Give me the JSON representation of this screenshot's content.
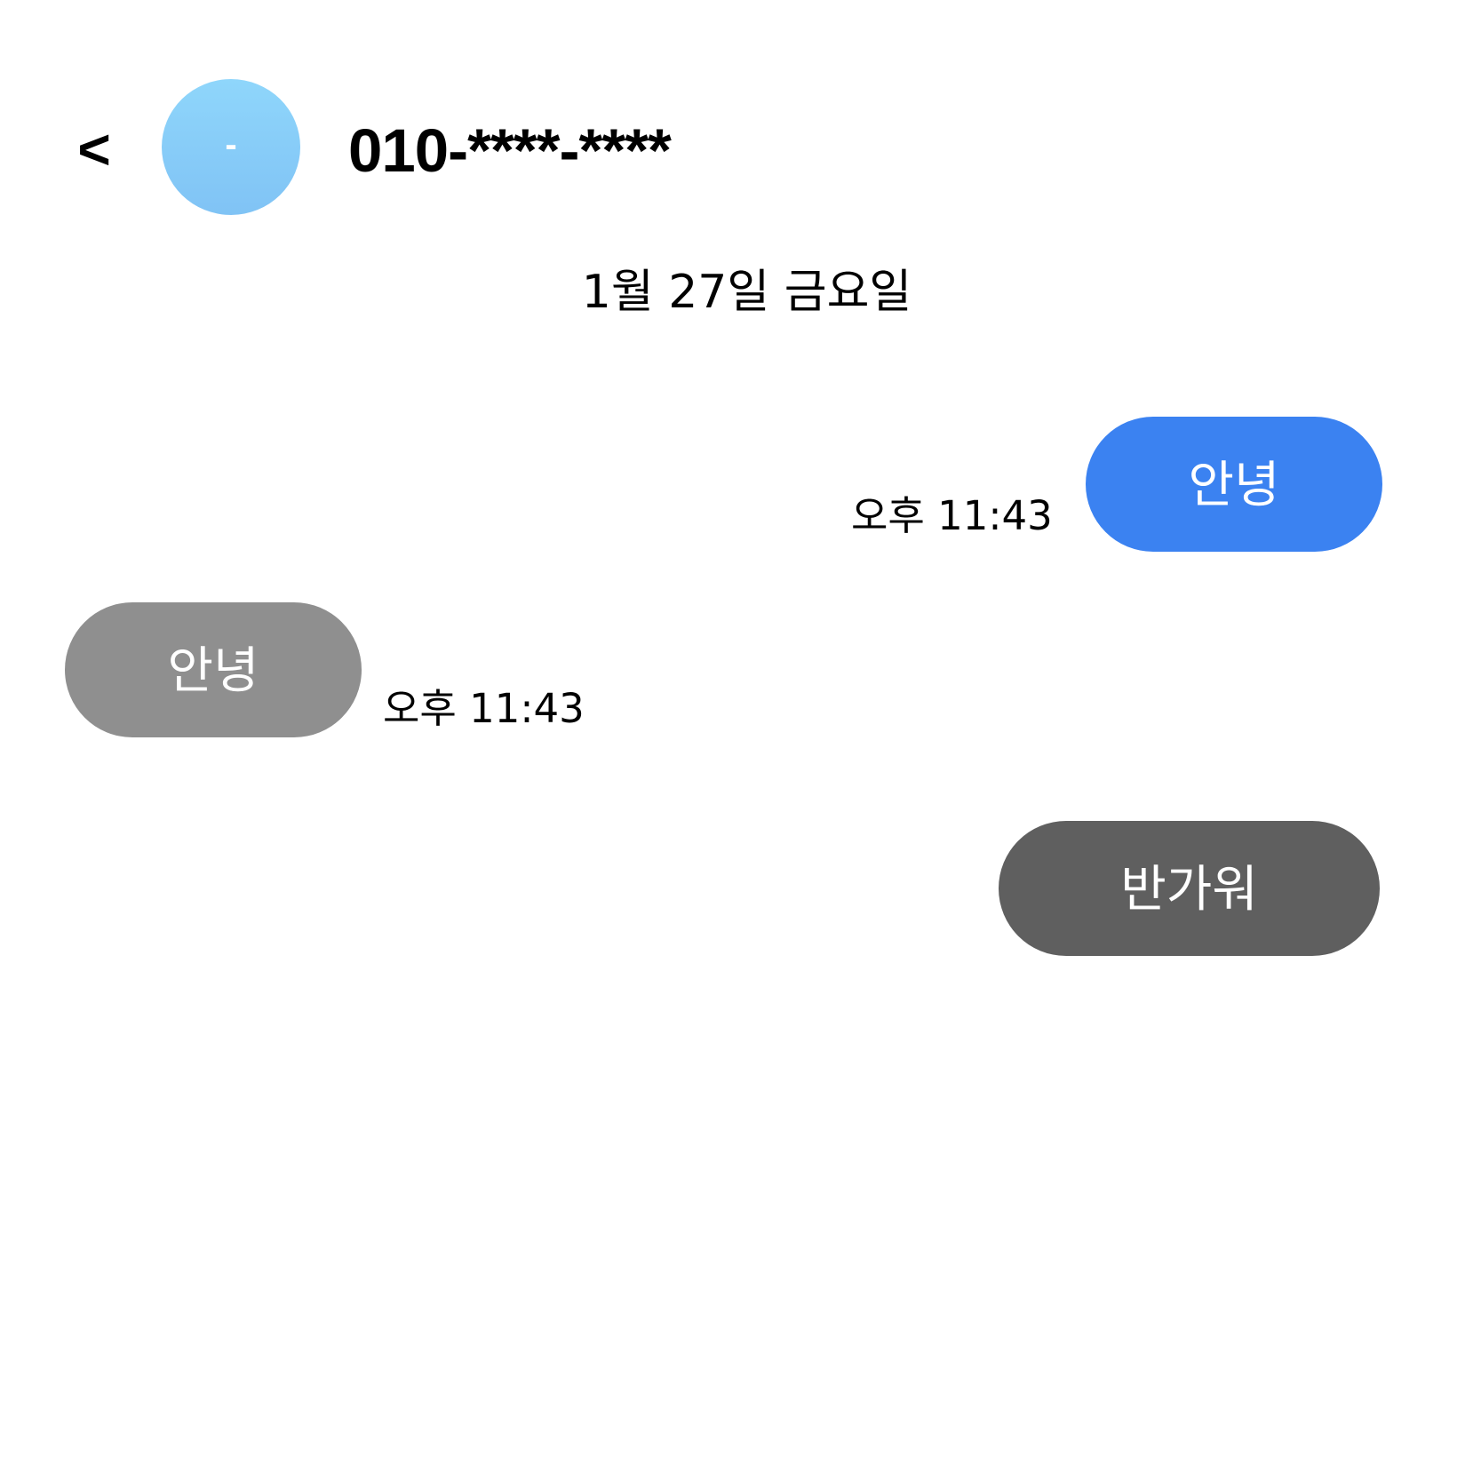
{
  "header": {
    "back_label": "<",
    "avatar_text": "-",
    "contact_name": "010-****-****"
  },
  "conversation": {
    "date": "1월 27일 금요일",
    "messages": [
      {
        "text": "안녕",
        "time": "오후 11:43",
        "direction": "sent",
        "color": "#3b82f1"
      },
      {
        "text": "안녕",
        "time": "오후 11:43",
        "direction": "received",
        "color": "#8f8f8f"
      },
      {
        "text": "반가워",
        "time": "",
        "direction": "sent",
        "color": "#5f5f5f"
      }
    ]
  },
  "colors": {
    "avatar_top": "#8fd6fb",
    "avatar_bottom": "#80c3f5",
    "background": "#ffffff"
  }
}
